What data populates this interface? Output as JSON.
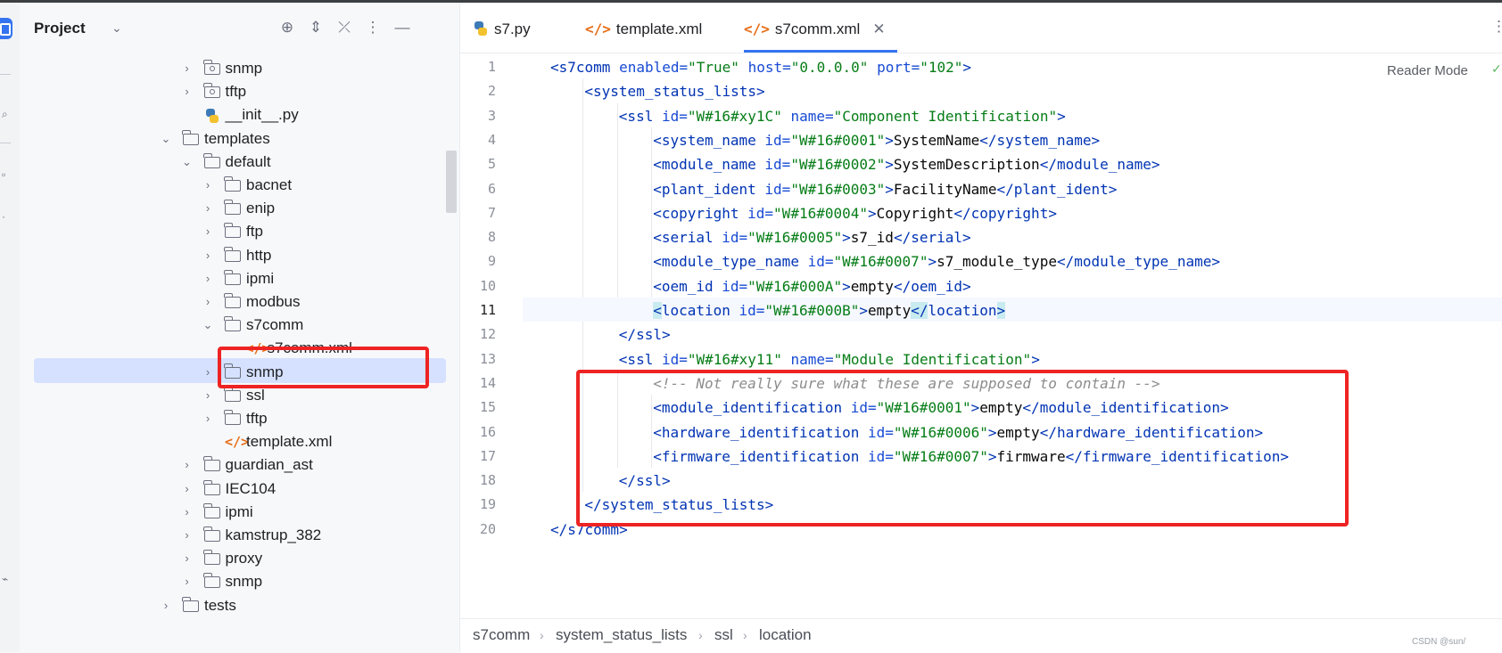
{
  "project_panel": {
    "title": "Project",
    "tree": [
      {
        "label": "snmp",
        "type": "package",
        "depth": 3,
        "arrow": "›"
      },
      {
        "label": "tftp",
        "type": "package",
        "depth": 3,
        "arrow": "›"
      },
      {
        "label": "__init__.py",
        "type": "python",
        "depth": 3,
        "arrow": ""
      },
      {
        "label": "templates",
        "type": "folder",
        "depth": 2,
        "arrow": "⌄"
      },
      {
        "label": "default",
        "type": "folder",
        "depth": 3,
        "arrow": "⌄"
      },
      {
        "label": "bacnet",
        "type": "folder",
        "depth": 4,
        "arrow": "›"
      },
      {
        "label": "enip",
        "type": "folder",
        "depth": 4,
        "arrow": "›"
      },
      {
        "label": "ftp",
        "type": "folder",
        "depth": 4,
        "arrow": "›"
      },
      {
        "label": "http",
        "type": "folder",
        "depth": 4,
        "arrow": "›"
      },
      {
        "label": "ipmi",
        "type": "folder",
        "depth": 4,
        "arrow": "›"
      },
      {
        "label": "modbus",
        "type": "folder",
        "depth": 4,
        "arrow": "›"
      },
      {
        "label": "s7comm",
        "type": "folder",
        "depth": 4,
        "arrow": "⌄"
      },
      {
        "label": "s7comm.xml",
        "type": "xml",
        "depth": 5,
        "arrow": "",
        "selected": true
      },
      {
        "label": "snmp",
        "type": "folder",
        "depth": 4,
        "arrow": "›"
      },
      {
        "label": "ssl",
        "type": "folder",
        "depth": 4,
        "arrow": "›"
      },
      {
        "label": "tftp",
        "type": "folder",
        "depth": 4,
        "arrow": "›"
      },
      {
        "label": "template.xml",
        "type": "xml",
        "depth": 4,
        "arrow": ""
      },
      {
        "label": "guardian_ast",
        "type": "folder",
        "depth": 3,
        "arrow": "›"
      },
      {
        "label": "IEC104",
        "type": "folder",
        "depth": 3,
        "arrow": "›"
      },
      {
        "label": "ipmi",
        "type": "folder",
        "depth": 3,
        "arrow": "›"
      },
      {
        "label": "kamstrup_382",
        "type": "folder",
        "depth": 3,
        "arrow": "›"
      },
      {
        "label": "proxy",
        "type": "folder",
        "depth": 3,
        "arrow": "›"
      },
      {
        "label": "snmp",
        "type": "folder",
        "depth": 3,
        "arrow": "›"
      },
      {
        "label": "tests",
        "type": "folder",
        "depth": 2,
        "arrow": "›"
      }
    ]
  },
  "tabs": [
    {
      "label": "s7.py",
      "icon": "python-icon"
    },
    {
      "label": "template.xml",
      "icon": "xml-icon"
    },
    {
      "label": "s7comm.xml",
      "icon": "xml-icon",
      "active": true
    }
  ],
  "reader_mode": "Reader Mode",
  "editor": {
    "current_line": 11,
    "lines": [
      {
        "n": "1",
        "indent": 0,
        "tokens": [
          [
            "tg",
            "<s7comm"
          ],
          [
            "at",
            " enabled="
          ],
          [
            "av",
            "\"True\""
          ],
          [
            "at",
            " host="
          ],
          [
            "av",
            "\"0.0.0.0\""
          ],
          [
            "at",
            " port="
          ],
          [
            "av",
            "\"102\""
          ],
          [
            "tg",
            ">"
          ]
        ]
      },
      {
        "n": "2",
        "indent": 1,
        "tokens": [
          [
            "tg",
            "<system_status_lists>"
          ]
        ]
      },
      {
        "n": "3",
        "indent": 2,
        "tokens": [
          [
            "tg",
            "<ssl"
          ],
          [
            "at",
            " id="
          ],
          [
            "av",
            "\"W#16#xy1C\""
          ],
          [
            "at",
            " name="
          ],
          [
            "av",
            "\"Component Identification\""
          ],
          [
            "tg",
            ">"
          ]
        ]
      },
      {
        "n": "4",
        "indent": 3,
        "tokens": [
          [
            "tg",
            "<system_name"
          ],
          [
            "at",
            " id="
          ],
          [
            "av",
            "\"W#16#0001\""
          ],
          [
            "tg",
            ">"
          ],
          [
            "tx",
            "SystemName"
          ],
          [
            "tg",
            "</system_name>"
          ]
        ]
      },
      {
        "n": "5",
        "indent": 3,
        "tokens": [
          [
            "tg",
            "<module_name"
          ],
          [
            "at",
            " id="
          ],
          [
            "av",
            "\"W#16#0002\""
          ],
          [
            "tg",
            ">"
          ],
          [
            "tx",
            "SystemDescription"
          ],
          [
            "tg",
            "</module_name>"
          ]
        ]
      },
      {
        "n": "6",
        "indent": 3,
        "tokens": [
          [
            "tg",
            "<plant_ident"
          ],
          [
            "at",
            " id="
          ],
          [
            "av",
            "\"W#16#0003\""
          ],
          [
            "tg",
            ">"
          ],
          [
            "tx",
            "FacilityName"
          ],
          [
            "tg",
            "</plant_ident>"
          ]
        ]
      },
      {
        "n": "7",
        "indent": 3,
        "tokens": [
          [
            "tg",
            "<copyright"
          ],
          [
            "at",
            " id="
          ],
          [
            "av",
            "\"W#16#0004\""
          ],
          [
            "tg",
            ">"
          ],
          [
            "tx",
            "Copyright"
          ],
          [
            "tg",
            "</copyright>"
          ]
        ]
      },
      {
        "n": "8",
        "indent": 3,
        "tokens": [
          [
            "tg",
            "<serial"
          ],
          [
            "at",
            " id="
          ],
          [
            "av",
            "\"W#16#0005\""
          ],
          [
            "tg",
            ">"
          ],
          [
            "tx",
            "s7_id"
          ],
          [
            "tg",
            "</serial>"
          ]
        ]
      },
      {
        "n": "9",
        "indent": 3,
        "tokens": [
          [
            "tg",
            "<module_type_name"
          ],
          [
            "at",
            " id="
          ],
          [
            "av",
            "\"W#16#0007\""
          ],
          [
            "tg",
            ">"
          ],
          [
            "tx",
            "s7_module_type"
          ],
          [
            "tg",
            "</module_type_name>"
          ]
        ]
      },
      {
        "n": "10",
        "indent": 3,
        "tokens": [
          [
            "tg",
            "<oem_id"
          ],
          [
            "at",
            " id="
          ],
          [
            "av",
            "\"W#16#000A\""
          ],
          [
            "tg",
            ">"
          ],
          [
            "tx",
            "empty"
          ],
          [
            "tg",
            "</oem_id>"
          ]
        ]
      },
      {
        "n": "11",
        "indent": 3,
        "tokens": [
          [
            "tg hl",
            "<"
          ],
          [
            "tg",
            "location"
          ],
          [
            "at",
            " id="
          ],
          [
            "av",
            "\"W#16#000B\""
          ],
          [
            "tg",
            ">"
          ],
          [
            "tx",
            "empty"
          ],
          [
            "tg hl",
            "</"
          ],
          [
            "tg",
            "location"
          ],
          [
            "tg hl",
            ">"
          ]
        ]
      },
      {
        "n": "12",
        "indent": 2,
        "tokens": [
          [
            "tg",
            "</ssl>"
          ]
        ]
      },
      {
        "n": "13",
        "indent": 2,
        "tokens": [
          [
            "tg",
            "<ssl"
          ],
          [
            "at",
            " id="
          ],
          [
            "av",
            "\"W#16#xy11\""
          ],
          [
            "at",
            " name="
          ],
          [
            "av",
            "\"Module Identification\""
          ],
          [
            "tg",
            ">"
          ]
        ]
      },
      {
        "n": "14",
        "indent": 3,
        "tokens": [
          [
            "cm",
            "<!-- Not really sure what these are supposed to contain -->"
          ]
        ]
      },
      {
        "n": "15",
        "indent": 3,
        "tokens": [
          [
            "tg",
            "<module_identification"
          ],
          [
            "at",
            " id="
          ],
          [
            "av",
            "\"W#16#0001\""
          ],
          [
            "tg",
            ">"
          ],
          [
            "tx",
            "empty"
          ],
          [
            "tg",
            "</module_identification>"
          ]
        ]
      },
      {
        "n": "16",
        "indent": 3,
        "tokens": [
          [
            "tg",
            "<hardware_identification"
          ],
          [
            "at",
            " id="
          ],
          [
            "av",
            "\"W#16#0006\""
          ],
          [
            "tg",
            ">"
          ],
          [
            "tx",
            "empty"
          ],
          [
            "tg",
            "</hardware_identification>"
          ]
        ]
      },
      {
        "n": "17",
        "indent": 3,
        "tokens": [
          [
            "tg",
            "<firmware_identification"
          ],
          [
            "at",
            " id="
          ],
          [
            "av",
            "\"W#16#0007\""
          ],
          [
            "tg",
            ">"
          ],
          [
            "tx",
            "firmware"
          ],
          [
            "tg",
            "</firmware_identification>"
          ]
        ]
      },
      {
        "n": "18",
        "indent": 2,
        "tokens": [
          [
            "tg",
            "</ssl>"
          ]
        ]
      },
      {
        "n": "19",
        "indent": 1,
        "tokens": [
          [
            "tg",
            "</system_status_lists>"
          ]
        ]
      },
      {
        "n": "20",
        "indent": 0,
        "tokens": [
          [
            "tg",
            "</s7comm>"
          ]
        ]
      }
    ]
  },
  "breadcrumb": [
    "s7comm",
    "system_status_lists",
    "ssl",
    "location"
  ],
  "watermark": "CSDN @sun/",
  "colors": {
    "accent": "#3574f0",
    "annotation_red": "#ee2323",
    "selection": "#d5e1ff",
    "xml_icon": "#e66d17"
  }
}
